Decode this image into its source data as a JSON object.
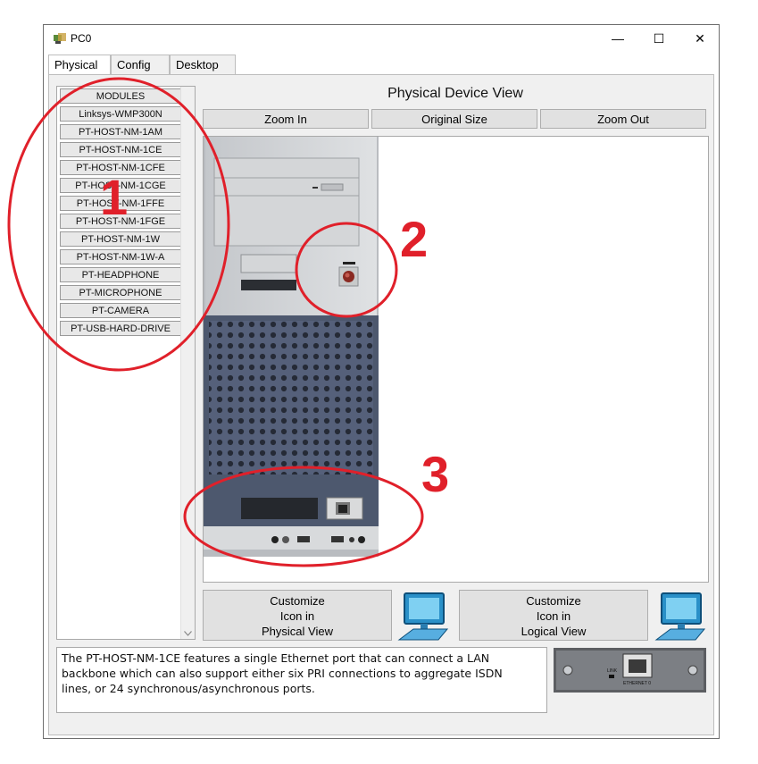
{
  "window": {
    "title": "PC0",
    "controls": {
      "minimize": "—",
      "maximize": "☐",
      "close": "✕"
    }
  },
  "tabs": [
    {
      "label": "Physical",
      "active": true
    },
    {
      "label": "Config",
      "active": false
    },
    {
      "label": "Desktop",
      "active": false
    }
  ],
  "modules": {
    "header": "MODULES",
    "items": [
      "Linksys-WMP300N",
      "PT-HOST-NM-1AM",
      "PT-HOST-NM-1CE",
      "PT-HOST-NM-1CFE",
      "PT-HOST-NM-1CGE",
      "PT-HOST-NM-1FFE",
      "PT-HOST-NM-1FGE",
      "PT-HOST-NM-1W",
      "PT-HOST-NM-1W-A",
      "PT-HEADPHONE",
      "PT-MICROPHONE",
      "PT-CAMERA",
      "PT-USB-HARD-DRIVE"
    ]
  },
  "physical_view": {
    "title": "Physical Device View",
    "zoom_in": "Zoom In",
    "original_size": "Original Size",
    "zoom_out": "Zoom Out"
  },
  "customize": {
    "physical": "Customize\nIcon in\nPhysical View",
    "logical": "Customize\nIcon in\nLogical View"
  },
  "description": "The PT-HOST-NM-1CE features a single Ethernet port that can connect a LAN\nbackbone which can also support either six PRI connections to aggregate ISDN\nlines, or 24 synchronous/asynchronous ports.",
  "module_image": {
    "link_label": "LINK",
    "port_label": "ETHERNET 0"
  },
  "annotations": {
    "one": "1",
    "two": "2",
    "three": "3",
    "color": "#e0202a"
  }
}
